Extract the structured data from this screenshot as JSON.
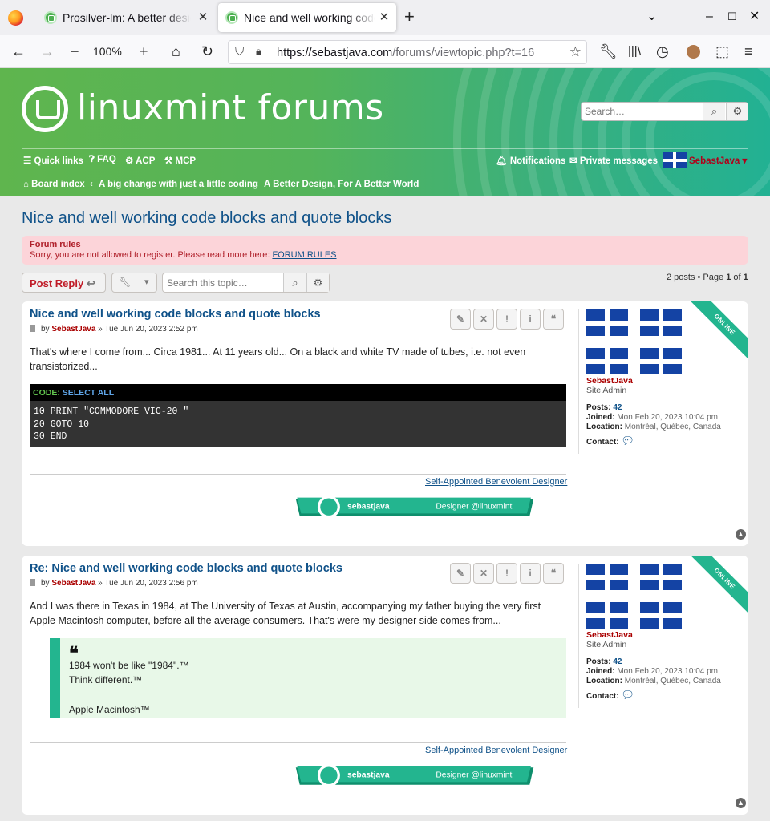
{
  "browser": {
    "tabs": [
      {
        "label": "Prosilver-lm: A better design"
      },
      {
        "label": "Nice and well working code blocks"
      }
    ],
    "zoom": "100%",
    "url_domain": "https://sebastjava.com",
    "url_path": "/forums/viewtopic.php?t=16"
  },
  "header": {
    "logo_text": "linuxmint forums",
    "search_placeholder": "Search…",
    "quick_links": "Quick links",
    "faq": "FAQ",
    "acp": "ACP",
    "mcp": "MCP",
    "notifications": "Notifications",
    "private_messages": "Private messages",
    "username": "SebastJava",
    "breadcrumbs": [
      "Board index",
      "A big change with just a little coding",
      "A Better Design, For A Better World"
    ]
  },
  "topic": {
    "title": "Nice and well working code blocks and quote blocks",
    "rules_heading": "Forum rules",
    "rules_text": "Sorry, you are not allowed to register. Please read more here: ",
    "rules_link": "FORUM RULES",
    "post_reply": "Post Reply",
    "search_placeholder": "Search this topic…",
    "page_prefix": "2 posts • Page ",
    "page_current": "1",
    "page_of": " of ",
    "page_total": "1"
  },
  "posts": [
    {
      "title": "Nice and well working code blocks and quote blocks",
      "by": "by",
      "author": "SebastJava",
      "date": "» Tue Jun 20, 2023 2:52 pm",
      "text": "That's where I come from... Circa 1981... At 11 years old... On a black and white TV made of tubes, i.e. not even transistorized...",
      "code_label": "CODE:",
      "code_select": "SELECT ALL",
      "code": "10 PRINT \"COMMODORE VIC-20 \"\n20 GOTO 10\n30 END",
      "sig_title": "Self-Appointed Benevolent Designer"
    },
    {
      "title": "Re: Nice and well working code blocks and quote blocks",
      "by": "by",
      "author": "SebastJava",
      "date": "» Tue Jun 20, 2023 2:56 pm",
      "text": "And I was there in Texas in 1984, at The University of Texas at Austin, accompanying my father buying the very first Apple Macintosh computer, before all the average consumers. That's were my designer side comes from...",
      "quote_lines": [
        "1984 won't be like \"1984\".™",
        "Think different.™",
        "Apple Macintosh™"
      ],
      "sig_title": "Self-Appointed Benevolent Designer"
    }
  ],
  "profile": {
    "name": "SebastJava",
    "rank": "Site Admin",
    "posts_label": "Posts:",
    "posts": "42",
    "joined_label": "Joined:",
    "joined": "Mon Feb 20, 2023 10:04 pm",
    "location_label": "Location:",
    "location": "Montréal, Québec, Canada",
    "contact_label": "Contact:",
    "online": "ONLINE"
  },
  "signature": {
    "name": "sebastjava",
    "role": "Designer @linuxmint"
  },
  "colors": {
    "accent": "#105289",
    "green": "#23b58f",
    "author": "#aa0000"
  }
}
